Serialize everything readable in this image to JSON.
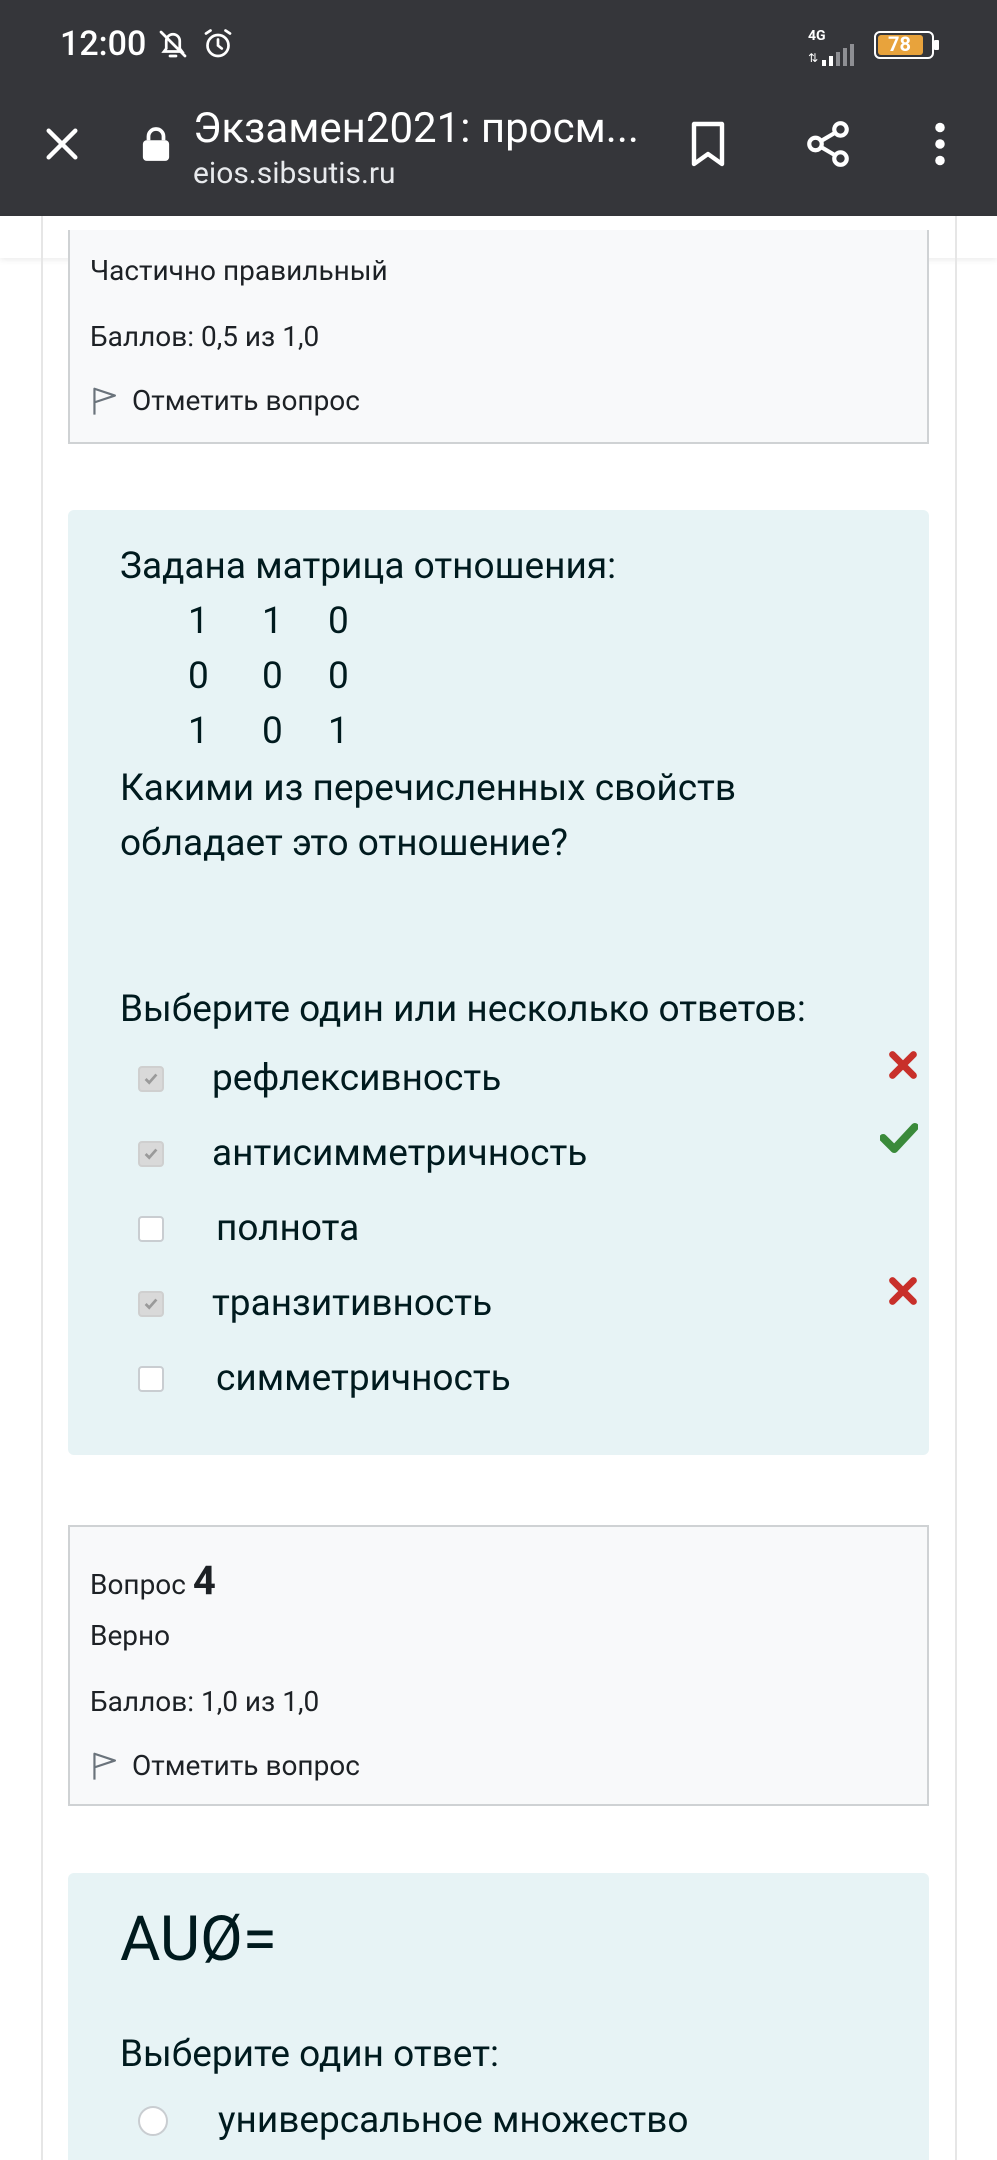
{
  "status_bar": {
    "time": "12:00",
    "network": "4G",
    "battery": "78"
  },
  "toolbar": {
    "title": "Экзамен2021: просм...",
    "url": "eios.sibsutis.ru"
  },
  "question3_info": {
    "state": "Частично правильный",
    "grade": "Баллов: 0,5 из 1,0",
    "flag_label": "Отметить вопрос"
  },
  "question3": {
    "prompt": "Задана матрица отношения:",
    "matrix": [
      [
        "1",
        "1",
        "0"
      ],
      [
        "0",
        "0",
        "0"
      ],
      [
        "1",
        "0",
        "1"
      ]
    ],
    "question_line1": "Какими из перечисленных свойств",
    "question_line2": "обладает это отношение?",
    "instruction": "Выберите один или несколько ответов:",
    "options": [
      {
        "label": "рефлексивность",
        "checked": true,
        "mark": "incorrect"
      },
      {
        "label": "антисимметричность",
        "checked": true,
        "mark": "correct"
      },
      {
        "label": "полнота",
        "checked": false,
        "mark": "none"
      },
      {
        "label": "транзитивность",
        "checked": true,
        "mark": "incorrect"
      },
      {
        "label": "симметричность",
        "checked": false,
        "mark": "none"
      }
    ]
  },
  "question4_info": {
    "label": "Вопрос",
    "number": "4",
    "state": "Верно",
    "grade": "Баллов: 1,0 из 1,0",
    "flag_label": "Отметить вопрос"
  },
  "question4": {
    "prompt": "AUØ=",
    "instruction": "Выберите один ответ:",
    "options": [
      {
        "label": "универсальное множество",
        "selected": false
      }
    ]
  },
  "colors": {
    "chrome": "#35363a",
    "question_bg": "#e7f3f5",
    "info_bg": "#f8f9fa",
    "correct": "#3a8a3a",
    "incorrect": "#c8302a",
    "battery": "#e8a33c"
  }
}
